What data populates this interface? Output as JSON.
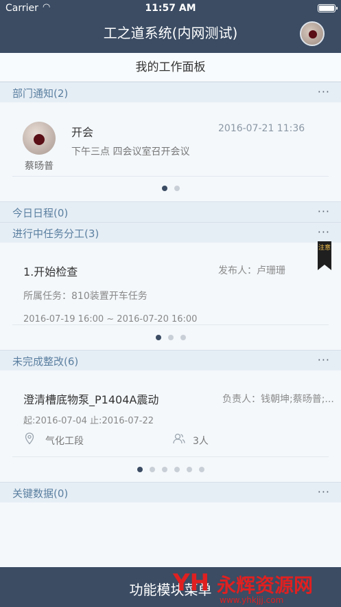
{
  "status_bar": {
    "carrier": "Carrier",
    "time": "11:57 AM"
  },
  "nav": {
    "title": "工之道系统(内网测试)"
  },
  "panel": {
    "title": "我的工作面板"
  },
  "sections": {
    "notice": {
      "label": "部门通知(2)",
      "more": "···"
    },
    "schedule": {
      "label": "今日日程(0)",
      "more": "···"
    },
    "tasks": {
      "label": "进行中任务分工(3)",
      "more": "···"
    },
    "rectify": {
      "label": "未完成整改(6)",
      "more": "···"
    },
    "keydata": {
      "label": "关键数据(0)",
      "more": "···"
    }
  },
  "notice_card": {
    "name": "蔡旸普",
    "title": "开会",
    "time": "2016-07-21 11:36",
    "desc": "下午三点 四会议室召开会议",
    "page_count": 2,
    "active_page": 0
  },
  "task_card": {
    "title": "1.开始检查",
    "publisher": "发布人：卢珊珊",
    "belong": "所属任务：810装置开车任务",
    "date_range": "2016-07-19 16:00 ~ 2016-07-20 16:00",
    "badge": "注意",
    "page_count": 3,
    "active_page": 0
  },
  "rectify_card": {
    "title": "澄清槽底物泵_P1404A震动",
    "owner": "负责人：钱朝坤;蔡旸普;...",
    "dates": "起:2016-07-04   止:2016-07-22",
    "location": "气化工段",
    "people": "3人",
    "page_count": 6,
    "active_page": 0
  },
  "bottom": {
    "label": "功能模块菜单"
  },
  "watermark": {
    "text": "永辉资源网",
    "url": "www.yhkjjj.com"
  },
  "colors": {
    "nav_bg": "#3b4c63",
    "section_label": "#5a7fa0",
    "watermark": "#e02020"
  }
}
